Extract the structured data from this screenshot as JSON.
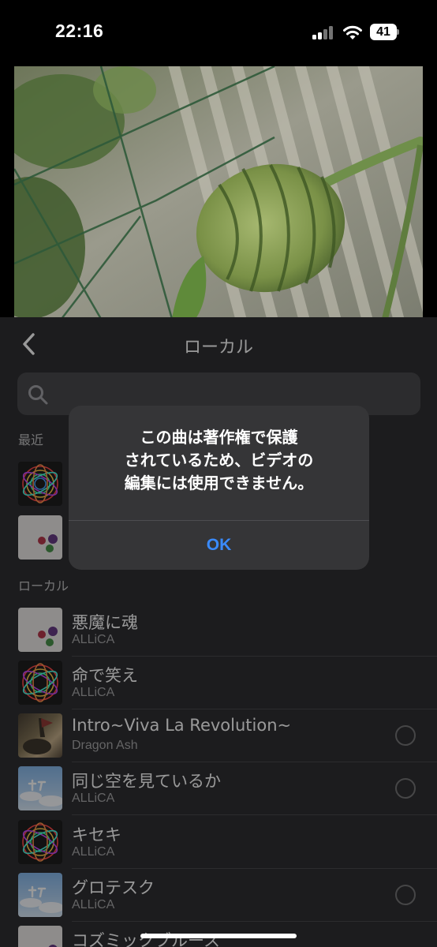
{
  "status_bar": {
    "time": "22:16",
    "battery": "41"
  },
  "sheet": {
    "title": "ローカル",
    "search_placeholder": "",
    "recent_label": "最近",
    "local_label": "ローカル"
  },
  "songs": [
    {
      "title": "悪魔に魂",
      "artist": "ALLiCA",
      "art": "flowers-white"
    },
    {
      "title": "命で笑え",
      "artist": "ALLiCA",
      "art": "life-mandala"
    },
    {
      "title": "Intro~Viva La Revolution~",
      "artist": "Dragon Ash",
      "art": "painting"
    },
    {
      "title": "同じ空を見ているか",
      "artist": "ALLiCA",
      "art": "sky"
    },
    {
      "title": "キセキ",
      "artist": "ALLiCA",
      "art": "life-mandala"
    },
    {
      "title": "グロテスク",
      "artist": "ALLiCA",
      "art": "sky"
    },
    {
      "title": "コズミックブルース",
      "artist": "",
      "art": "flowers-white"
    }
  ],
  "alert": {
    "message_lines": [
      "この曲は著作権で保護",
      "されているため、ビデオの",
      "編集には使用できません。"
    ],
    "ok_label": "OK"
  },
  "colors": {
    "accent": "#3a8bff",
    "sheet_bg": "#1c1c1e",
    "alert_bg": "#353537"
  }
}
